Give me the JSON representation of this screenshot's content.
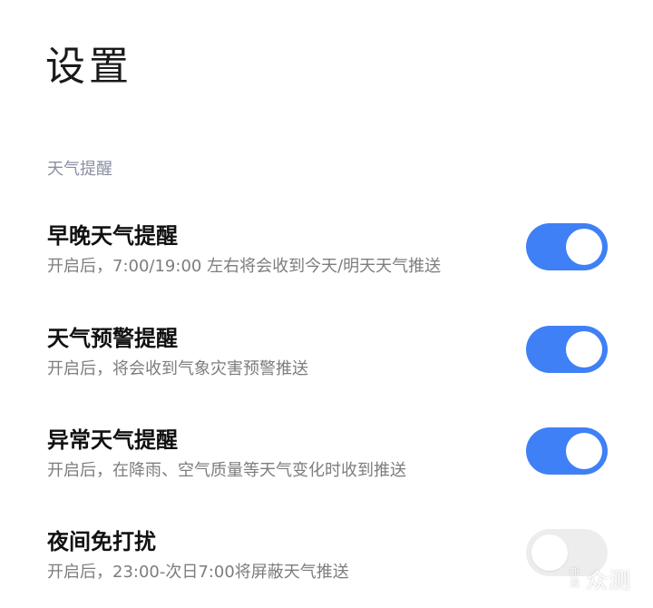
{
  "page": {
    "title": "设置"
  },
  "section": {
    "header": "天气提醒"
  },
  "settings": [
    {
      "title": "早晚天气提醒",
      "description": "开启后，7:00/19:00 左右将会收到今天/明天天气推送",
      "enabled": true
    },
    {
      "title": "天气预警提醒",
      "description": "开启后，将会收到气象灾害预警推送",
      "enabled": true
    },
    {
      "title": "异常天气提醒",
      "description": "开启后，在降雨、空气质量等天气变化时收到推送",
      "enabled": true
    },
    {
      "title": "夜间免打扰",
      "description": "开启后，23:00-次日7:00将屏蔽天气推送",
      "enabled": false
    }
  ],
  "watermark": {
    "small_top": "新",
    "small_bottom": "浪",
    "big": "众测"
  },
  "colors": {
    "toggle_on": "#3f80f6",
    "toggle_off": "#ededed",
    "section_header": "#8a8fa3",
    "description": "#7d7d7d"
  }
}
